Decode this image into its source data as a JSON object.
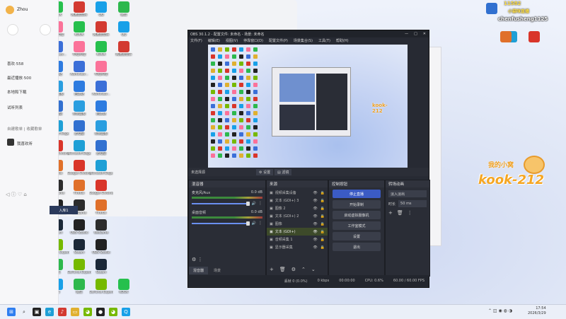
{
  "desktop": {
    "icons": [
      {
        "label": "Administr...",
        "color": "#3b6fd8"
      },
      {
        "label": "回收站",
        "color": "#2d7be0"
      },
      {
        "label": "控制面板",
        "color": "#2a9ee0"
      },
      {
        "label": "此电脑",
        "color": "#3170d0"
      },
      {
        "label": "Microsoft Edge",
        "color": "#1e9fd6"
      },
      {
        "label": "Google Chrome",
        "color": "#d9352a"
      },
      {
        "label": "Firefox",
        "color": "#e0702a"
      },
      {
        "label": "WeGame",
        "color": "#2c2c2c"
      },
      {
        "label": "OBS Studio",
        "color": "#222"
      },
      {
        "label": "Steam",
        "color": "#1b2838"
      },
      {
        "label": "GeForce Experience",
        "color": "#76b900"
      },
      {
        "label": "微信",
        "color": "#2db84d"
      },
      {
        "label": "QQ",
        "color": "#18a0e8"
      },
      {
        "label": "网易云音乐",
        "color": "#d33a31"
      },
      {
        "label": "KOOK",
        "color": "#26c04d"
      },
      {
        "label": "哔哩哔哩",
        "color": "#fb7299"
      }
    ]
  },
  "music_app": {
    "user": "Zhou",
    "items": [
      "喜欢·558",
      "最近播放·500",
      "本地和下载",
      "试听列表"
    ],
    "section": "自建歌单 | 收藏歌单",
    "playlist": "我喜欢听",
    "play_btn": "入库1"
  },
  "obs": {
    "title": "OBS 30.1.2 - 配置文件: 未命名 - 场景: 未命名",
    "menu": [
      "文件(F)",
      "编辑(E)",
      "视图(V)",
      "停靠窗口(D)",
      "配置文件(P)",
      "场景集合(S)",
      "工具(T)",
      "帮助(H)"
    ],
    "scene_bar": {
      "label": "未选择源",
      "settings": "设置",
      "filters": "滤镜"
    },
    "mixer": {
      "title": "混音器",
      "channels": [
        {
          "name": "麦克风/Aux",
          "db": "0.0 dB"
        },
        {
          "name": "桌面音频",
          "db": "0.0 dB"
        }
      ],
      "tabs": [
        "混音器",
        "场景"
      ]
    },
    "sources": {
      "title": "来源",
      "items": [
        {
          "name": "视频采集设备",
          "sel": false
        },
        {
          "name": "文本 (GDI+) 3",
          "sel": false
        },
        {
          "name": "图像 2",
          "sel": false
        },
        {
          "name": "文本 (GDI+) 2",
          "sel": false
        },
        {
          "name": "图像",
          "sel": false
        },
        {
          "name": "文本 (GDI+)",
          "sel": true
        },
        {
          "name": "音频采集 1",
          "sel": false
        },
        {
          "name": "显示器采集",
          "sel": false
        }
      ]
    },
    "controls": {
      "title": "控制按钮",
      "buttons": [
        "停止直播",
        "开始录制",
        "启动虚拟摄像机",
        "工作室模式",
        "设置",
        "退出"
      ]
    },
    "transitions": {
      "title": "转场动画",
      "type": "淡入淡出",
      "duration_label": "时长",
      "duration": "50 ms"
    },
    "status": {
      "dropped": "丢帧 0 (0.0%)",
      "bitrate": "0 kbps",
      "time": "00:00:00",
      "cpu": "CPU: 0.6%",
      "fps": "60.00 / 60.00 FPS"
    }
  },
  "overlay": {
    "top_num": "11582",
    "top_text": "小猫咪直播",
    "handle": "chenfusheng1125",
    "kook": "kook-212",
    "kook_top": "我的小窝"
  },
  "taskbar": {
    "time": "17:54",
    "date": "2026/3/29"
  }
}
